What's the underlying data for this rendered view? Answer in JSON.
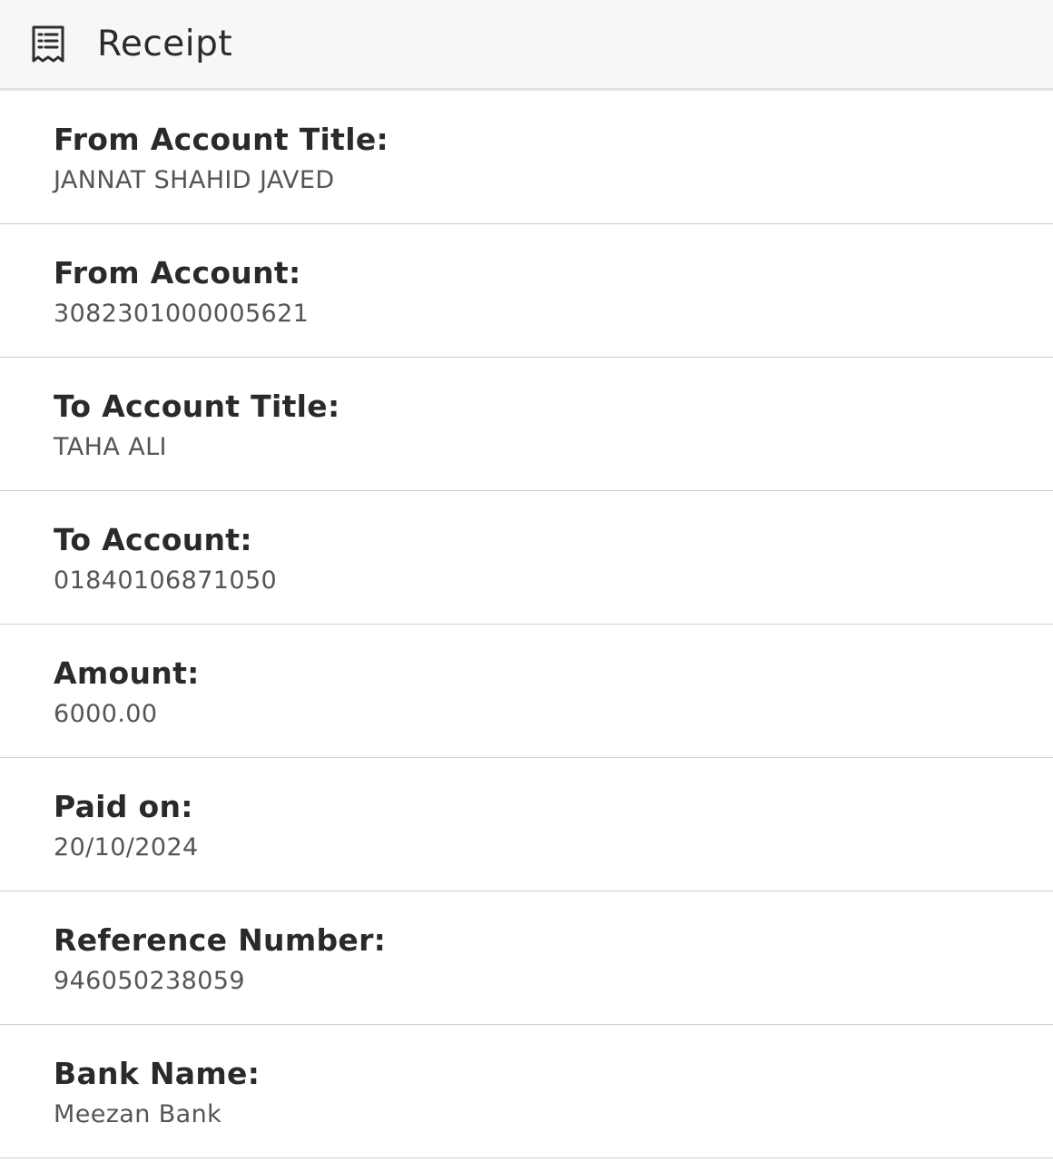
{
  "header": {
    "icon": "receipt-icon",
    "title": "Receipt"
  },
  "fields": [
    {
      "label": "From Account Title:",
      "value": "JANNAT SHAHID JAVED"
    },
    {
      "label": "From Account:",
      "value": "3082301000005621"
    },
    {
      "label": "To Account Title:",
      "value": "TAHA ALI"
    },
    {
      "label": "To Account:",
      "value": "01840106871050"
    },
    {
      "label": "Amount:",
      "value": "6000.00"
    },
    {
      "label": "Paid on:",
      "value": "20/10/2024"
    },
    {
      "label": "Reference Number:",
      "value": "946050238059"
    },
    {
      "label": "Bank Name:",
      "value": "Meezan Bank"
    }
  ]
}
